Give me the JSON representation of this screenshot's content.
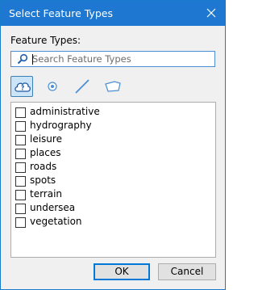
{
  "window": {
    "title": "Select Feature Types",
    "close_icon": "close-icon"
  },
  "feature_types_label": "Feature Types:",
  "search": {
    "placeholder": "Search Feature Types",
    "value": "",
    "icon": "search-icon"
  },
  "filters": [
    {
      "name": "all-types",
      "icon": "question-cloud-icon",
      "selected": true
    },
    {
      "name": "point",
      "icon": "point-icon",
      "selected": false
    },
    {
      "name": "line",
      "icon": "line-icon",
      "selected": false
    },
    {
      "name": "polygon",
      "icon": "polygon-icon",
      "selected": false
    }
  ],
  "feature_types": [
    {
      "label": "administrative",
      "checked": false
    },
    {
      "label": "hydrography",
      "checked": false
    },
    {
      "label": "leisure",
      "checked": false
    },
    {
      "label": "places",
      "checked": false
    },
    {
      "label": "roads",
      "checked": false
    },
    {
      "label": "spots",
      "checked": false
    },
    {
      "label": "terrain",
      "checked": false
    },
    {
      "label": "undersea",
      "checked": false
    },
    {
      "label": "vegetation",
      "checked": false
    }
  ],
  "buttons": {
    "ok": "OK",
    "cancel": "Cancel"
  },
  "colors": {
    "titlebar": "#1e78d2",
    "accent": "#0078d7",
    "selected_bg": "#cce4f7"
  }
}
